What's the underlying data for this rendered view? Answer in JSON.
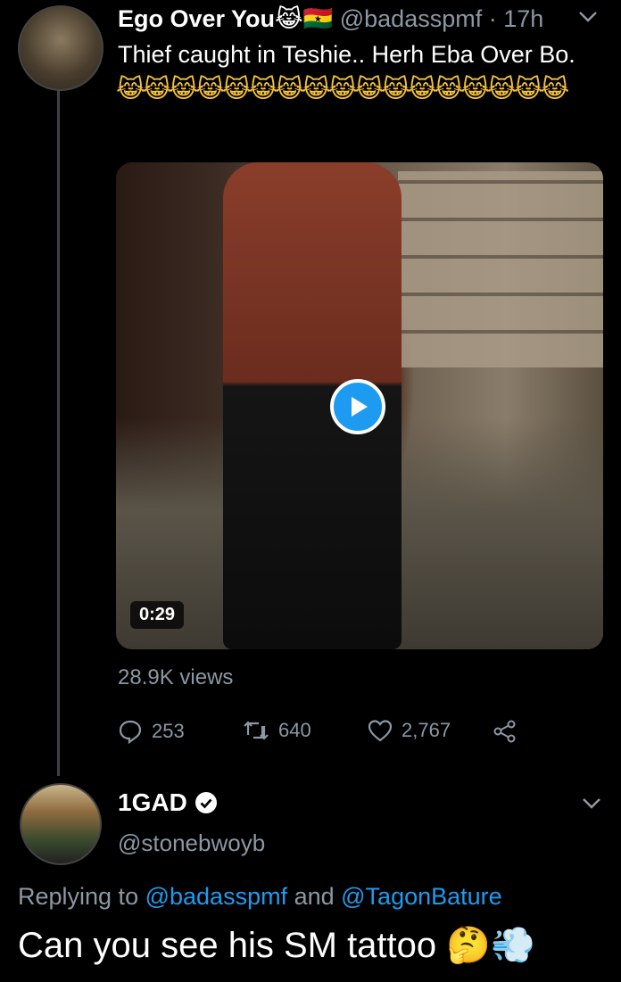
{
  "tweet": {
    "author_name": "Ego Over You",
    "author_name_emojis": "😹🇬🇭",
    "handle": "@badasspmf",
    "separator": " · ",
    "time": "17h",
    "text": "Thief caught in Teshie.. Herh Eba Over Bo.",
    "emojis": "😹😹😹😹😹😹😹😹😹😹😹😹😹😹😹😹😹",
    "video": {
      "duration": "0:29",
      "play_icon": "play-icon"
    },
    "views": "28.9K views",
    "actions": {
      "replies": "253",
      "retweets": "640",
      "likes": "2,767"
    }
  },
  "reply": {
    "author_name": "1GAD",
    "verified_icon": "verified-badge-icon",
    "handle": "@stonebwoyb",
    "replying_prefix": "Replying to ",
    "mention1": "@badasspmf",
    "conjunction": " and ",
    "mention2": "@TagonBature",
    "text": "Can you see his SM tattoo",
    "text_emojis": "🤔💨"
  },
  "colors": {
    "background": "#000000",
    "muted": "#8b98a5",
    "accent": "#1d9bf0",
    "thread_line": "#3d4246"
  }
}
